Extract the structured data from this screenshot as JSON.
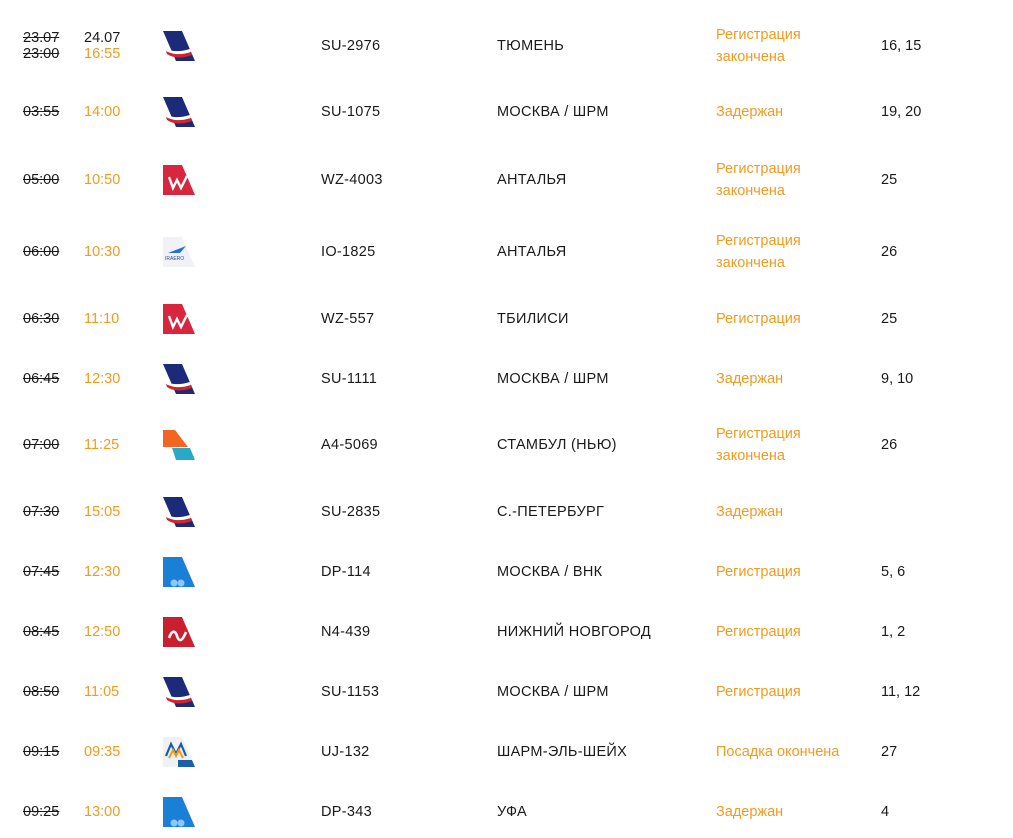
{
  "flights": [
    {
      "sched_date": "23.07",
      "sched": "23:00",
      "actual_date": "24.07",
      "actual": "16:55",
      "airline": "aeroflot",
      "flight": "SU-2976",
      "dest": "ТЮМЕНЬ",
      "status1": "Регистрация",
      "status2": "закончена",
      "counters": "16, 15"
    },
    {
      "sched": "03:55",
      "actual": "14:00",
      "airline": "aeroflot",
      "flight": "SU-1075",
      "dest": "МОСКВА / ШРМ",
      "status1": "Задержан",
      "status2": "",
      "counters": "19, 20"
    },
    {
      "sched": "05:00",
      "actual": "10:50",
      "airline": "redwings",
      "flight": "WZ-4003",
      "dest": "АНТАЛЬЯ",
      "status1": "Регистрация",
      "status2": "закончена",
      "counters": "25"
    },
    {
      "sched": "06:00",
      "actual": "10:30",
      "airline": "iraero",
      "flight": "IO-1825",
      "dest": "АНТАЛЬЯ",
      "status1": "Регистрация",
      "status2": "закончена",
      "counters": "26"
    },
    {
      "sched": "06:30",
      "actual": "11:10",
      "airline": "redwings",
      "flight": "WZ-557",
      "dest": "ТБИЛИСИ",
      "status1": "Регистрация",
      "status2": "",
      "counters": "25"
    },
    {
      "sched": "06:45",
      "actual": "12:30",
      "airline": "aeroflot",
      "flight": "SU-1111",
      "dest": "МОСКВА / ШРМ",
      "status1": "Задержан",
      "status2": "",
      "counters": "9, 10"
    },
    {
      "sched": "07:00",
      "actual": "11:25",
      "airline": "ajet",
      "flight": "A4-5069",
      "dest": "СТАМБУЛ (НЬЮ)",
      "status1": "Регистрация",
      "status2": "закончена",
      "counters": "26"
    },
    {
      "sched": "07:30",
      "actual": "15:05",
      "airline": "aeroflot",
      "flight": "SU-2835",
      "dest": "С.-ПЕТЕРБУРГ",
      "status1": "Задержан",
      "status2": "",
      "counters": ""
    },
    {
      "sched": "07:45",
      "actual": "12:30",
      "airline": "pobeda",
      "flight": "DP-114",
      "dest": "МОСКВА / ВНК",
      "status1": "Регистрация",
      "status2": "",
      "counters": "5, 6"
    },
    {
      "sched": "08:45",
      "actual": "12:50",
      "airline": "nordwind",
      "flight": "N4-439",
      "dest": "НИЖНИЙ НОВГОРОД",
      "status1": "Регистрация",
      "status2": "",
      "counters": "1, 2"
    },
    {
      "sched": "08:50",
      "actual": "11:05",
      "airline": "aeroflot",
      "flight": "SU-1153",
      "dest": "МОСКВА / ШРМ",
      "status1": "Регистрация",
      "status2": "",
      "counters": "11, 12"
    },
    {
      "sched": "09:15",
      "actual": "09:35",
      "airline": "alrosa",
      "flight": "UJ-132",
      "dest": "ШАРМ-ЭЛЬ-ШЕЙХ",
      "status1": "Посадка окончена",
      "status2": "",
      "counters": "27"
    },
    {
      "sched": "09:25",
      "actual": "13:00",
      "airline": "pobeda",
      "flight": "DP-343",
      "dest": "УФА",
      "status1": "Задержан",
      "status2": "",
      "counters": "4"
    }
  ],
  "colors": {
    "accent": "#f39a1d",
    "text": "#1a1a1a"
  }
}
